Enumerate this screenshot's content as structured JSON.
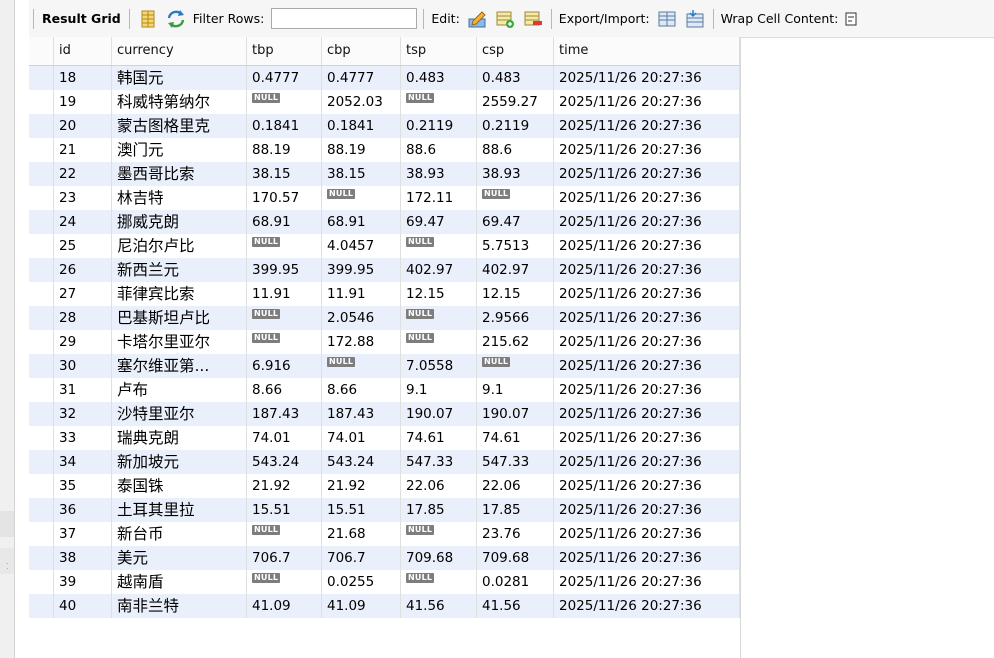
{
  "toolbar": {
    "result_grid": "Result Grid",
    "filter_rows": "Filter Rows:",
    "filter_value": "",
    "edit": "Edit:",
    "export_import": "Export/Import:",
    "wrap_cell": "Wrap Cell Content:"
  },
  "columns": [
    "id",
    "currency",
    "tbp",
    "cbp",
    "tsp",
    "csp",
    "time"
  ],
  "null_text": "NULL",
  "rows": [
    [
      "18",
      "韩国元",
      "0.4777",
      "0.4777",
      "0.483",
      "0.483",
      "2025/11/26 20:27:36"
    ],
    [
      "19",
      "科威特第纳尔",
      null,
      "2052.03",
      null,
      "2559.27",
      "2025/11/26 20:27:36"
    ],
    [
      "20",
      "蒙古图格里克",
      "0.1841",
      "0.1841",
      "0.2119",
      "0.2119",
      "2025/11/26 20:27:36"
    ],
    [
      "21",
      "澳门元",
      "88.19",
      "88.19",
      "88.6",
      "88.6",
      "2025/11/26 20:27:36"
    ],
    [
      "22",
      "墨西哥比索",
      "38.15",
      "38.15",
      "38.93",
      "38.93",
      "2025/11/26 20:27:36"
    ],
    [
      "23",
      "林吉特",
      "170.57",
      null,
      "172.11",
      null,
      "2025/11/26 20:27:36"
    ],
    [
      "24",
      "挪威克朗",
      "68.91",
      "68.91",
      "69.47",
      "69.47",
      "2025/11/26 20:27:36"
    ],
    [
      "25",
      "尼泊尔卢比",
      null,
      "4.0457",
      null,
      "5.7513",
      "2025/11/26 20:27:36"
    ],
    [
      "26",
      "新西兰元",
      "399.95",
      "399.95",
      "402.97",
      "402.97",
      "2025/11/26 20:27:36"
    ],
    [
      "27",
      "菲律宾比索",
      "11.91",
      "11.91",
      "12.15",
      "12.15",
      "2025/11/26 20:27:36"
    ],
    [
      "28",
      "巴基斯坦卢比",
      null,
      "2.0546",
      null,
      "2.9566",
      "2025/11/26 20:27:36"
    ],
    [
      "29",
      "卡塔尔里亚尔",
      null,
      "172.88",
      null,
      "215.62",
      "2025/11/26 20:27:36"
    ],
    [
      "30",
      "塞尔维亚第...",
      "6.916",
      null,
      "7.0558",
      null,
      "2025/11/26 20:27:36"
    ],
    [
      "31",
      "卢布",
      "8.66",
      "8.66",
      "9.1",
      "9.1",
      "2025/11/26 20:27:36"
    ],
    [
      "32",
      "沙特里亚尔",
      "187.43",
      "187.43",
      "190.07",
      "190.07",
      "2025/11/26 20:27:36"
    ],
    [
      "33",
      "瑞典克朗",
      "74.01",
      "74.01",
      "74.61",
      "74.61",
      "2025/11/26 20:27:36"
    ],
    [
      "34",
      "新加坡元",
      "543.24",
      "543.24",
      "547.33",
      "547.33",
      "2025/11/26 20:27:36"
    ],
    [
      "35",
      "泰国铢",
      "21.92",
      "21.92",
      "22.06",
      "22.06",
      "2025/11/26 20:27:36"
    ],
    [
      "36",
      "土耳其里拉",
      "15.51",
      "15.51",
      "17.85",
      "17.85",
      "2025/11/26 20:27:36"
    ],
    [
      "37",
      "新台币",
      null,
      "21.68",
      null,
      "23.76",
      "2025/11/26 20:27:36"
    ],
    [
      "38",
      "美元",
      "706.7",
      "706.7",
      "709.68",
      "709.68",
      "2025/11/26 20:27:36"
    ],
    [
      "39",
      "越南盾",
      null,
      "0.0255",
      null,
      "0.0281",
      "2025/11/26 20:27:36"
    ],
    [
      "40",
      "南非兰特",
      "41.09",
      "41.09",
      "41.56",
      "41.56",
      "2025/11/26 20:27:36"
    ]
  ]
}
